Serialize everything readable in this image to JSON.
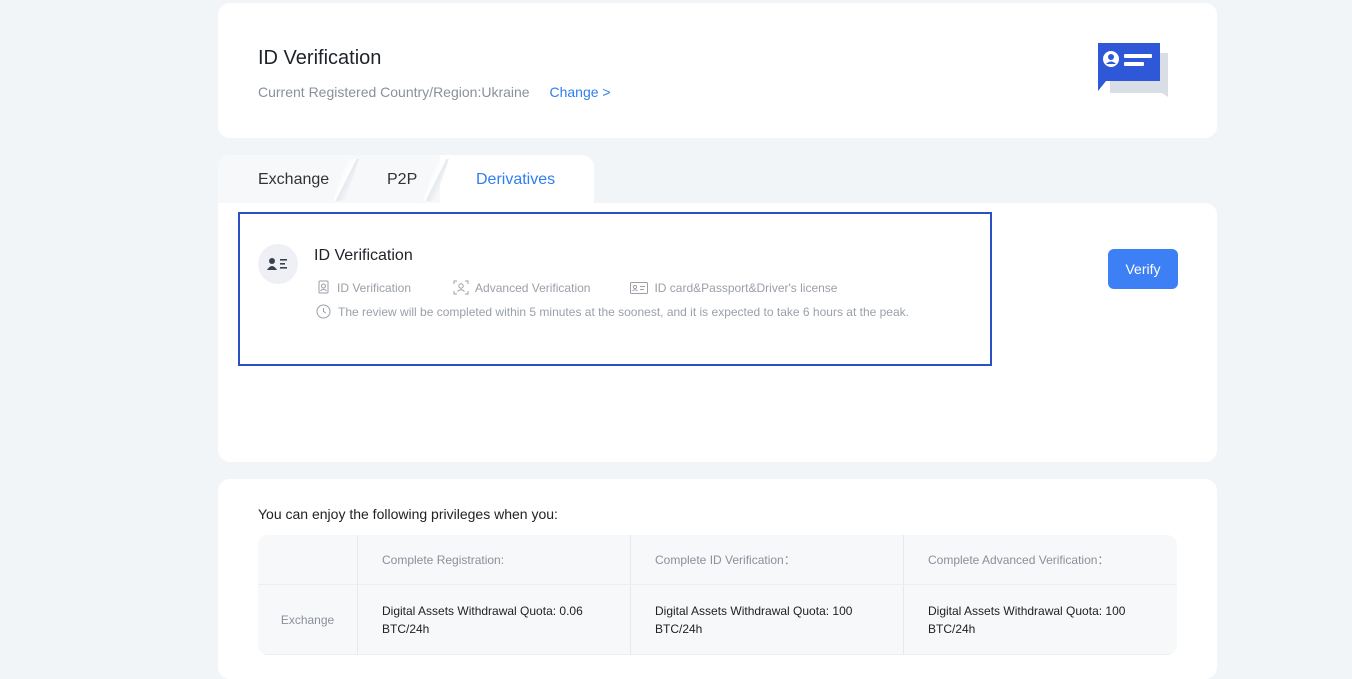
{
  "header": {
    "title": "ID Verification",
    "country_label": "Current Registered Country/Region:Ukraine",
    "change_link": "Change >"
  },
  "tabs": [
    {
      "label": "Exchange",
      "active": false
    },
    {
      "label": "P2P",
      "active": false
    },
    {
      "label": "Derivatives",
      "active": true
    }
  ],
  "verification": {
    "title": "ID Verification",
    "items": [
      {
        "icon": "id-doc-icon",
        "label": "ID Verification"
      },
      {
        "icon": "face-scan-icon",
        "label": "Advanced Verification"
      },
      {
        "icon": "id-card-icon",
        "label": "ID card&Passport&Driver's license"
      }
    ],
    "note": "The review will be completed within 5 minutes at the soonest, and it is expected to take 6 hours at the peak.",
    "verify_button": "Verify"
  },
  "privileges": {
    "title": "You can enjoy the following privileges when you:",
    "columns": [
      "",
      "Complete Registration:",
      "Complete ID Verification：",
      "Complete Advanced Verification："
    ],
    "rows": [
      {
        "label": "Exchange",
        "values": [
          "Digital Assets Withdrawal Quota: 0.06 BTC/24h",
          "Digital Assets Withdrawal Quota: 100 BTC/24h",
          "Digital Assets Withdrawal Quota: 100 BTC/24h"
        ]
      }
    ]
  },
  "colors": {
    "accent": "#2f7ef0",
    "button": "#3d7ff5",
    "selection_border": "#2b4fc4",
    "page_bg": "#f2f5f8"
  }
}
